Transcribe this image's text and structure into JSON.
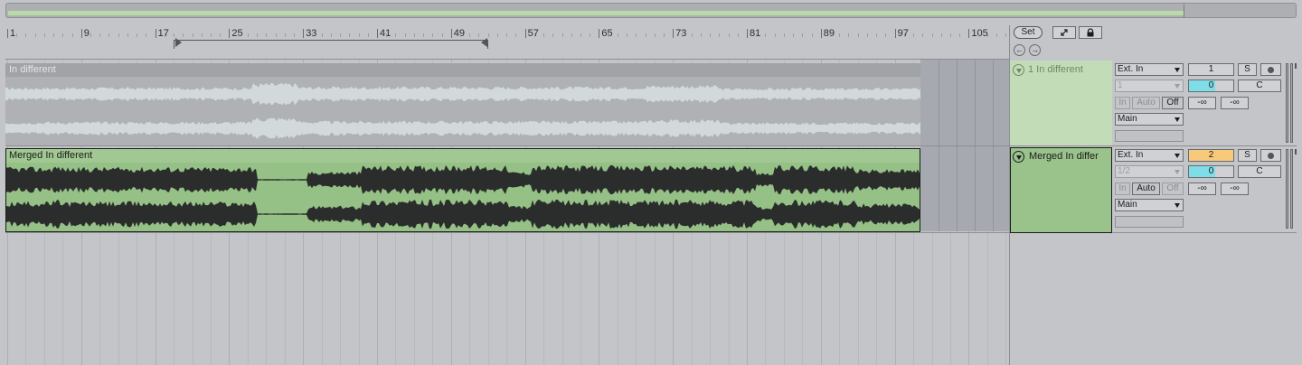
{
  "ruler": {
    "bar_numbers": [
      "1",
      "9",
      "17",
      "25",
      "33",
      "41",
      "49",
      "57",
      "65",
      "73",
      "81",
      "89",
      "97",
      "105"
    ],
    "set_label": "Set"
  },
  "icons": {
    "expand": "expand-icon",
    "lock": "lock-icon",
    "prev_locator": "arrow-left-icon",
    "next_locator": "arrow-right-icon",
    "prev_glyph": "←",
    "next_glyph": "→"
  },
  "tracks": [
    {
      "clip_name": "In different",
      "track_name": "1 In different",
      "input_type": "Ext. In",
      "input_channel": "1",
      "monitor": [
        "In",
        "Auto",
        "Off"
      ],
      "output": "Main",
      "track_number": "1",
      "solo_label": "S",
      "volume": "0",
      "volume_fraction": 0.6,
      "pan": "C",
      "send_a": "-∞",
      "send_b": "-∞",
      "color": "#c2dcb7"
    },
    {
      "clip_name": "Merged In different",
      "track_name": "Merged In differ",
      "input_type": "Ext. In",
      "input_channel": "1/2",
      "monitor": [
        "In",
        "Auto",
        "Off"
      ],
      "output": "Main",
      "track_number": "2",
      "solo_label": "S",
      "volume": "0",
      "volume_fraction": 0.6,
      "pan": "C",
      "send_a": "-∞",
      "send_b": "-∞",
      "color": "#9ac28b",
      "number_color": "#f7c97a"
    }
  ]
}
